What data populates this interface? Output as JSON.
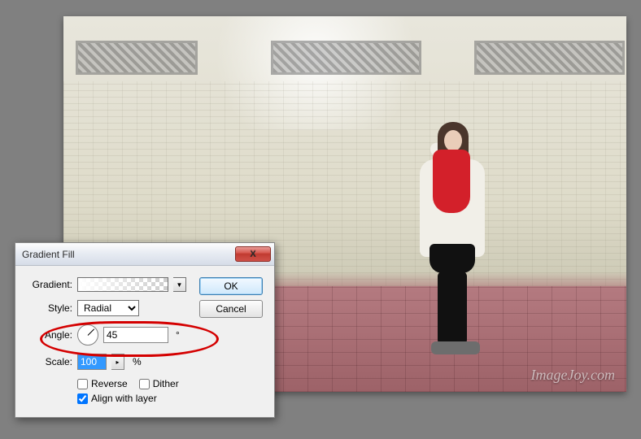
{
  "watermark": "ImageJoy.com",
  "dialog": {
    "title": "Gradient Fill",
    "gradient_label": "Gradient:",
    "style_label": "Style:",
    "style_value": "Radial",
    "angle_label": "Angle:",
    "angle_value": "45",
    "angle_unit": "°",
    "scale_label": "Scale:",
    "scale_value": "100",
    "scale_unit": "%",
    "reverse_label": "Reverse",
    "dither_label": "Dither",
    "align_label": "Align with layer",
    "reverse_checked": false,
    "dither_checked": false,
    "align_checked": true,
    "ok_label": "OK",
    "cancel_label": "Cancel",
    "close_glyph": "X"
  }
}
